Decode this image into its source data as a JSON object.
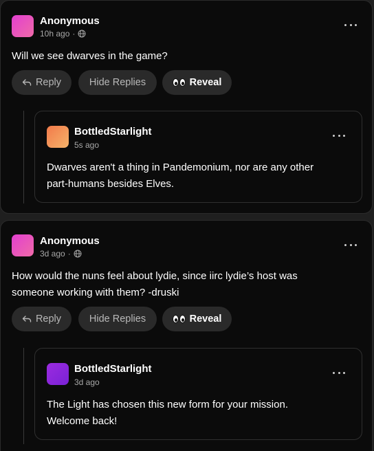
{
  "comments": [
    {
      "author": "Anonymous",
      "time": "10h ago",
      "visibility_separator": "·",
      "text": "Will we see dwarves in the game?",
      "avatar_gradient": [
        "#e23fd0",
        "#f06aa8"
      ],
      "actions": {
        "reply": "Reply",
        "hide_replies": "Hide Replies",
        "reveal": "Reveal"
      },
      "reply": {
        "author": "BottledStarlight",
        "time": "5s ago",
        "text_line1": "Dwarves aren't a thing in Pandemonium, nor are any other",
        "text_line2": "part-humans besides Elves.",
        "avatar_gradient": [
          "#f27a4a",
          "#f5b36a"
        ]
      }
    },
    {
      "author": "Anonymous",
      "time": "3d ago",
      "visibility_separator": "·",
      "text_line1": "How would the nuns feel about lydie, since iirc lydie’s host was",
      "text_line2": "someone working with them? -druski",
      "avatar_gradient": [
        "#e23fd0",
        "#f06aa8"
      ],
      "actions": {
        "reply": "Reply",
        "hide_replies": "Hide Replies",
        "reveal": "Reveal"
      },
      "reply": {
        "author": "BottledStarlight",
        "time": "3d ago",
        "text_line1": "The Light has chosen this new form for your mission.",
        "text_line2": "Welcome back!",
        "avatar_gradient": [
          "#9b2be0",
          "#7a22d6"
        ]
      }
    }
  ],
  "icons": {
    "more": "more-options-icon",
    "globe": "globe-icon",
    "reply_arrow": "reply-arrow-icon",
    "reveal": "eyes-icon"
  }
}
